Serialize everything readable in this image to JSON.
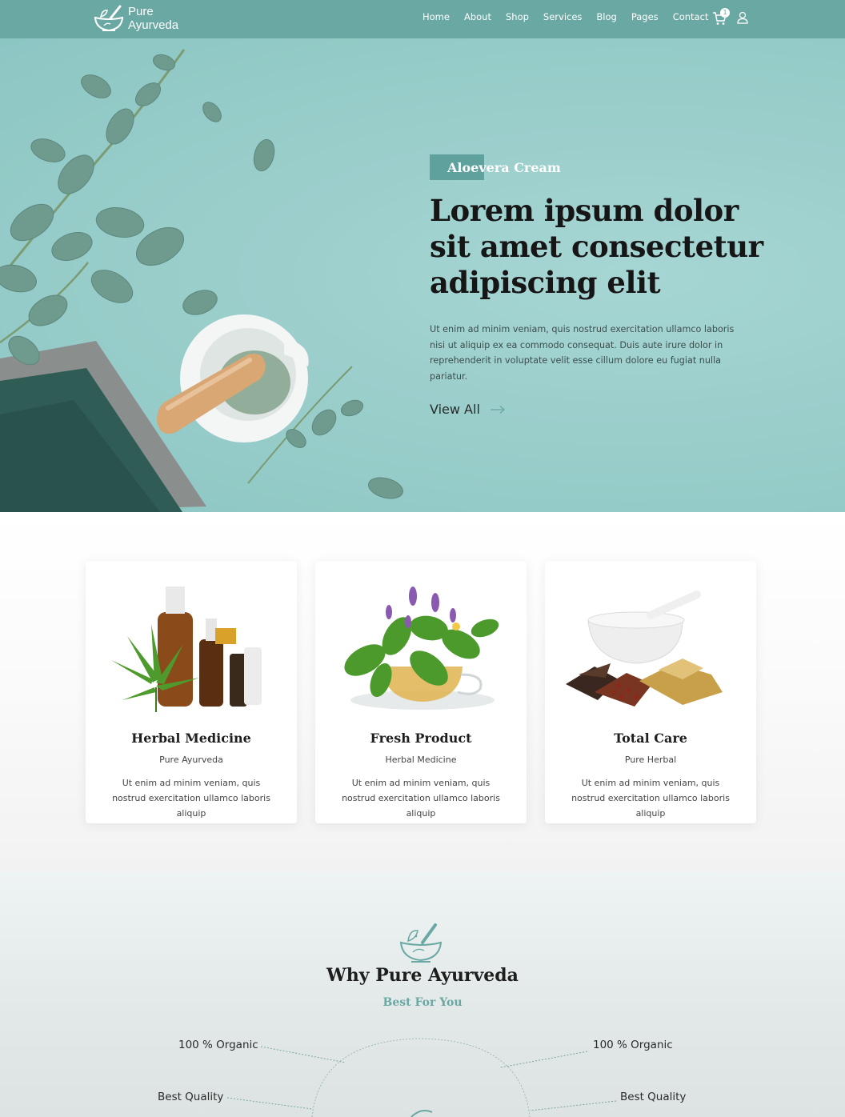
{
  "brand": {
    "name_line1": "Pure",
    "name_line2": "Ayurveda"
  },
  "nav": {
    "items": [
      {
        "label": "Home"
      },
      {
        "label": "About"
      },
      {
        "label": "Shop"
      },
      {
        "label": "Services"
      },
      {
        "label": "Blog"
      },
      {
        "label": "Pages"
      },
      {
        "label": "Contact"
      }
    ],
    "cart_count": "1"
  },
  "hero": {
    "tag": "Aloevera Cream",
    "title": "Lorem ipsum dolor sit amet consectetur adipiscing elit",
    "description": "Ut enim ad minim veniam, quis nostrud exercitation ullamco laboris nisi ut aliquip ex ea commodo consequat. Duis aute irure dolor in reprehenderit in voluptate velit esse cillum dolore eu fugiat nulla pariatur.",
    "cta": "View All"
  },
  "features": [
    {
      "title": "Herbal Medicine",
      "subtitle": "Pure Ayurveda",
      "description": "Ut enim ad minim veniam, quis nostrud exercitation ullamco laboris aliquip"
    },
    {
      "title": "Fresh Product",
      "subtitle": "Herbal Medicine",
      "description": "Ut enim ad minim veniam, quis nostrud exercitation ullamco laboris aliquip"
    },
    {
      "title": "Total Care",
      "subtitle": "Pure Herbal",
      "description": "Ut enim ad minim veniam, quis nostrud exercitation ullamco laboris aliquip"
    }
  ],
  "why": {
    "title": "Why Pure Ayurveda",
    "subtitle": "Best For You",
    "left_items": [
      "100 % Organic",
      "Best Quality"
    ],
    "right_items": [
      "100 % Organic",
      "Best Quality"
    ]
  },
  "colors": {
    "brand": "#6aa8a3",
    "hero_bg": "#9ccfcc",
    "heading": "#161616"
  }
}
